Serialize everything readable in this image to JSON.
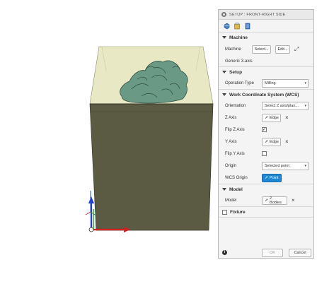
{
  "panel": {
    "title": "SETUP : FRONT-RIGHT SIDE",
    "sections": {
      "machine": {
        "header": "Machine",
        "machine_label": "Machine",
        "select_button": "Select...",
        "edit_button": "Edit...",
        "machine_name": "Generic 3-axis"
      },
      "setup": {
        "header": "Setup",
        "operation_type_label": "Operation Type",
        "operation_type_value": "Milling"
      },
      "wcs": {
        "header": "Work Coordinate System (WCS)",
        "orientation_label": "Orientation",
        "orientation_value": "Select Z axis/plan...",
        "z_axis_label": "Z Axis",
        "z_axis_value": "Edge",
        "flip_z_label": "Flip Z Axis",
        "flip_z_checked": true,
        "y_axis_label": "Y Axis",
        "y_axis_value": "Edge",
        "flip_y_label": "Flip Y Axis",
        "flip_y_checked": false,
        "origin_label": "Origin",
        "origin_value": "Selected point",
        "wcs_origin_label": "WCS Origin",
        "wcs_origin_value": "Point"
      },
      "model": {
        "header": "Model",
        "model_label": "Model",
        "model_value": "2 Bodies"
      },
      "fixture": {
        "label": "Fixture",
        "checked": false
      }
    },
    "footer": {
      "ok": "OK",
      "cancel": "Cancel"
    }
  },
  "colors": {
    "stock_front": "#5b5a43",
    "stock_top": "#e9e8c4",
    "part": "#6a9a86",
    "wcs_origin_active": "#1e88d4"
  }
}
